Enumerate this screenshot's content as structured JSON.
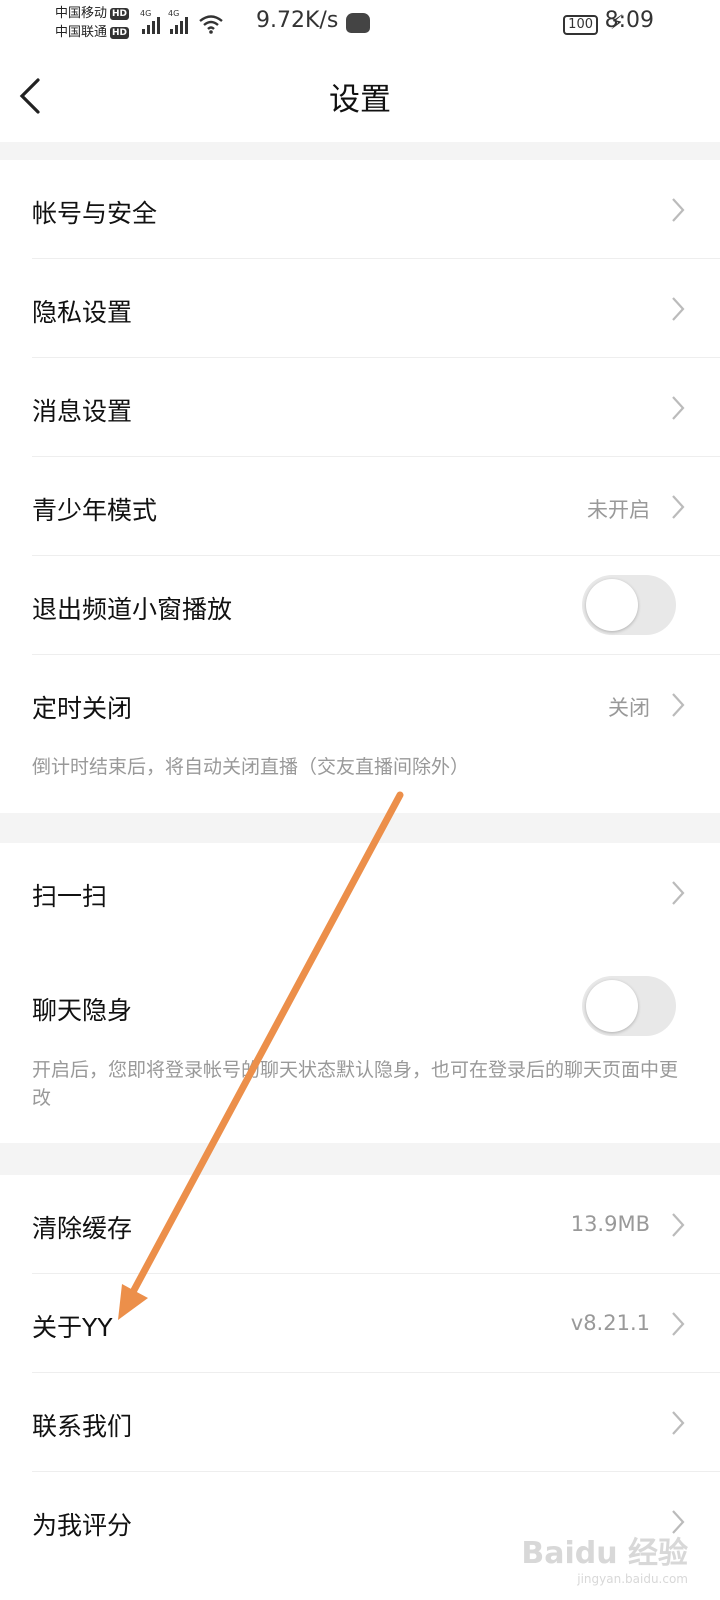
{
  "status_bar": {
    "carrier1": "中国移动",
    "carrier2": "中国联通",
    "hd": "HD",
    "network": "4G",
    "speed": "9.72K/s",
    "battery": "100",
    "time": "8:09"
  },
  "header": {
    "title": "设置",
    "back_icon": "chevron-left-icon"
  },
  "sections": {
    "s1": {
      "account": {
        "label": "帐号与安全"
      },
      "privacy": {
        "label": "隐私设置"
      },
      "message": {
        "label": "消息设置"
      },
      "teen": {
        "label": "青少年模式",
        "value": "未开启"
      },
      "mini_window": {
        "label": "退出频道小窗播放",
        "toggle_on": false
      },
      "timer": {
        "label": "定时关闭",
        "value": "关闭",
        "hint": "倒计时结束后，将自动关闭直播（交友直播间除外）"
      }
    },
    "s2": {
      "scan": {
        "label": "扫一扫"
      },
      "chat_invisible": {
        "label": "聊天隐身",
        "toggle_on": false,
        "hint": "开启后，您即将登录帐号的聊天状态默认隐身，也可在登录后的聊天页面中更改"
      }
    },
    "s3": {
      "cache": {
        "label": "清除缓存",
        "value": "13.9MB"
      },
      "about": {
        "label": "关于YY",
        "value": "v8.21.1"
      },
      "contact": {
        "label": "联系我们"
      },
      "rate": {
        "label": "为我评分"
      }
    }
  },
  "overlay": {
    "arrow_color": "#ec8f4a",
    "watermark": "Baidu 经验",
    "watermark_url": "jingyan.baidu.com"
  }
}
